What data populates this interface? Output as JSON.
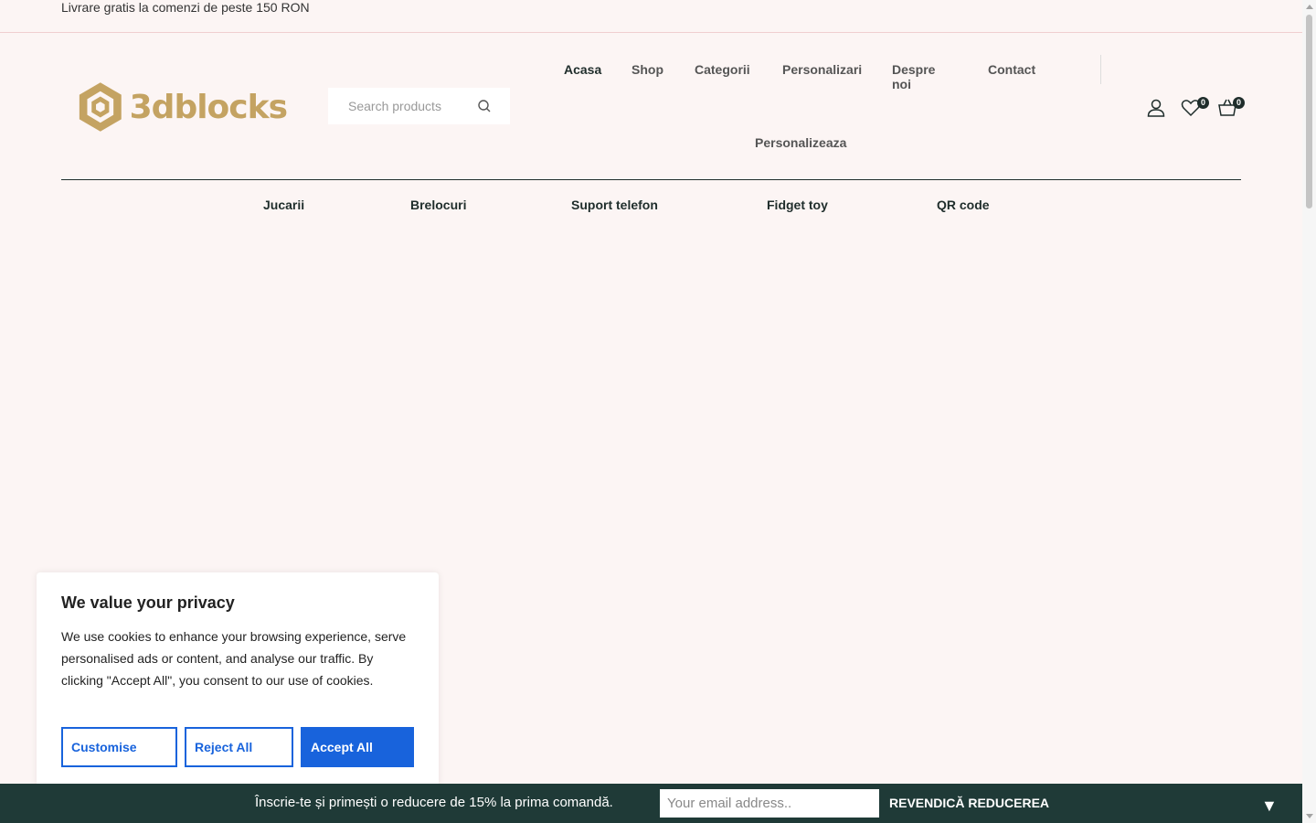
{
  "topbar": {
    "text": "Livrare gratis la comenzi de peste 150 RON"
  },
  "logo": {
    "text": "3dblocks",
    "color": "#c4a362"
  },
  "search": {
    "placeholder": "Search products"
  },
  "nav": {
    "items": [
      "Acasa",
      "Shop",
      "Categorii",
      "Personalizari",
      "Despre noi",
      "Contact"
    ],
    "second": "Personalizeaza"
  },
  "header_icons": {
    "account": "user-icon",
    "wishlist": "heart-icon",
    "wishlist_count": "0",
    "cart": "basket-icon",
    "cart_count": "0"
  },
  "categories": [
    "Jucarii",
    "Brelocuri",
    "Suport telefon",
    "Fidget toy",
    "QR code"
  ],
  "cookie": {
    "title": "We value your privacy",
    "text": "We use cookies to enhance your browsing experience, serve personalised ads or content, and analyse our traffic. By clicking \"Accept All\", you consent to our use of cookies.",
    "customise": "Customise",
    "reject": "Reject All",
    "accept": "Accept All",
    "accent": "#1863dc"
  },
  "newsletter": {
    "text": "Înscrie-te și primești o reducere de 15% la prima comandă.",
    "placeholder": "Your email address..",
    "button": "REVENDICĂ REDUCEREA",
    "toggle": "▼",
    "bg": "#1f3a37"
  }
}
